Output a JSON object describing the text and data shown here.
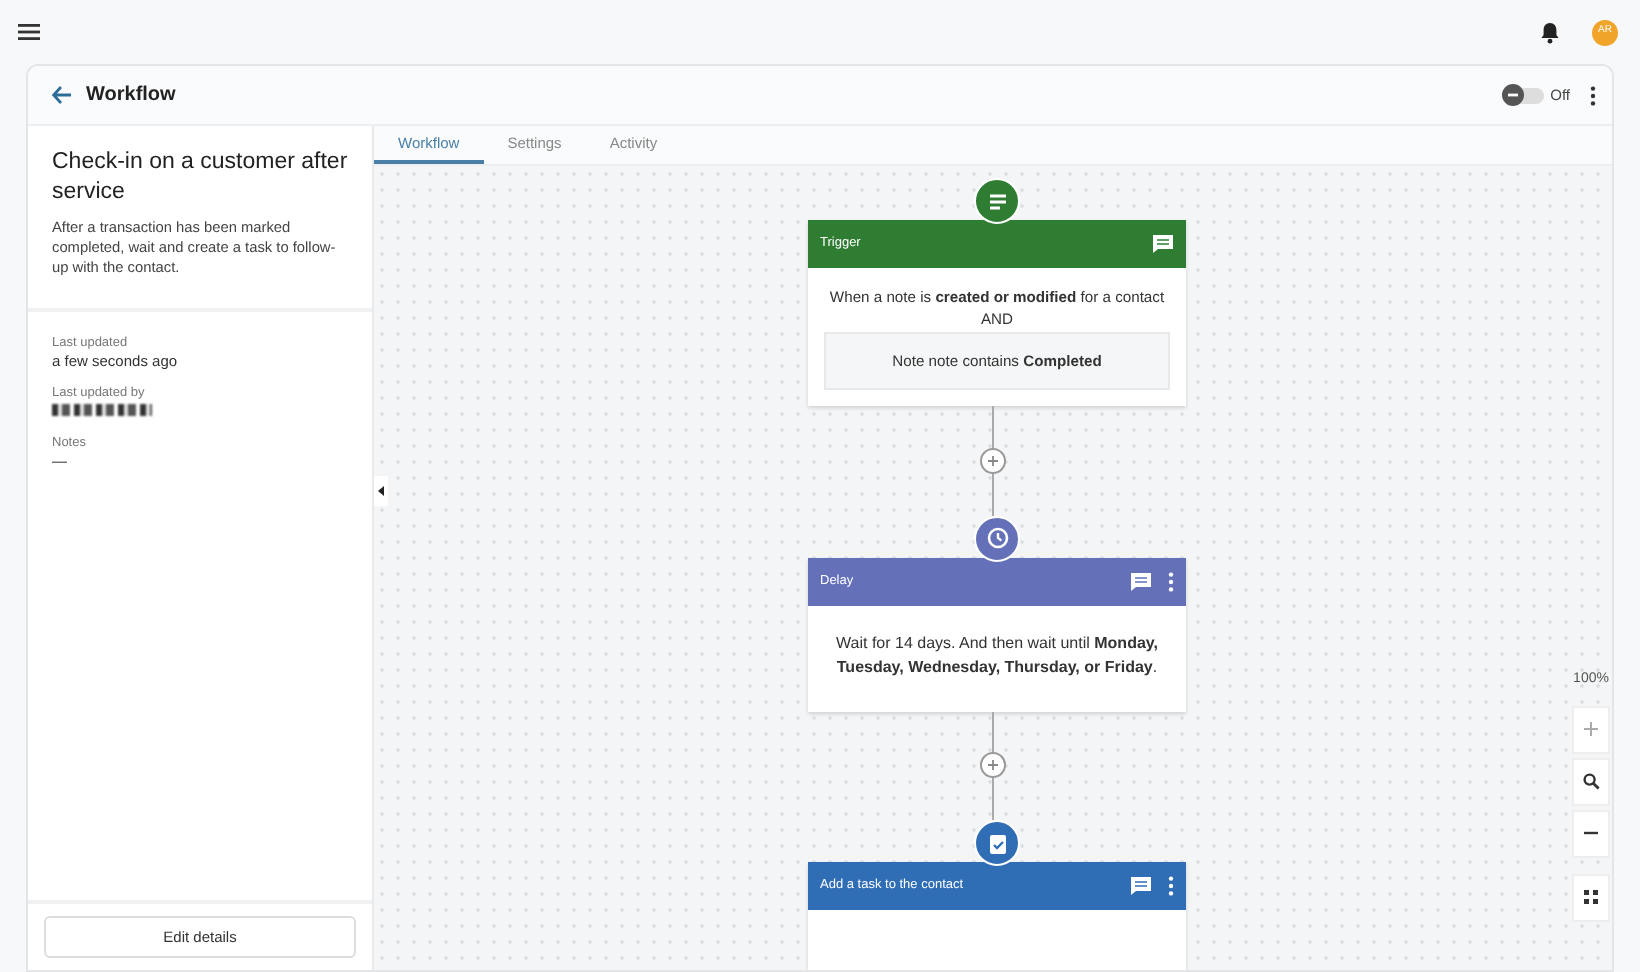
{
  "top_bar": {
    "avatar": "AR"
  },
  "header": {
    "title": "Workflow",
    "toggle": {
      "label": "Off",
      "on": false
    }
  },
  "details": {
    "title": "Check-in on a customer after service",
    "description": "After a transaction has been marked completed, wait and create a task to follow-up with the contact.",
    "fields": [
      {
        "label": "Last updated",
        "value": "a few seconds ago"
      },
      {
        "label": "Last updated by",
        "redacted": true
      },
      {
        "label": "Notes",
        "value": "—"
      }
    ],
    "button": "Edit details"
  },
  "tabs": [
    {
      "label": "Workflow",
      "selected": true
    },
    {
      "label": "Settings",
      "selected": false
    },
    {
      "label": "Activity",
      "selected": false
    }
  ],
  "nodes": [
    {
      "kind": "trigger",
      "title": "Trigger",
      "color": "#2e7d32",
      "menu": false,
      "text": "When a note is **created or modified** for a contact",
      "joiner": "AND",
      "condition": "Note note contains **Completed**"
    },
    {
      "kind": "delay",
      "title": "Delay",
      "color": "#6470b8",
      "menu": true,
      "text": "Wait for 14 days. And then wait until **Monday, Tuesday, Wednesday, Thursday, or Friday**."
    },
    {
      "kind": "task",
      "title": "Add a task to the contact",
      "color": "#2f6db5",
      "menu": true
    }
  ],
  "zoom": {
    "reading": "100%"
  }
}
